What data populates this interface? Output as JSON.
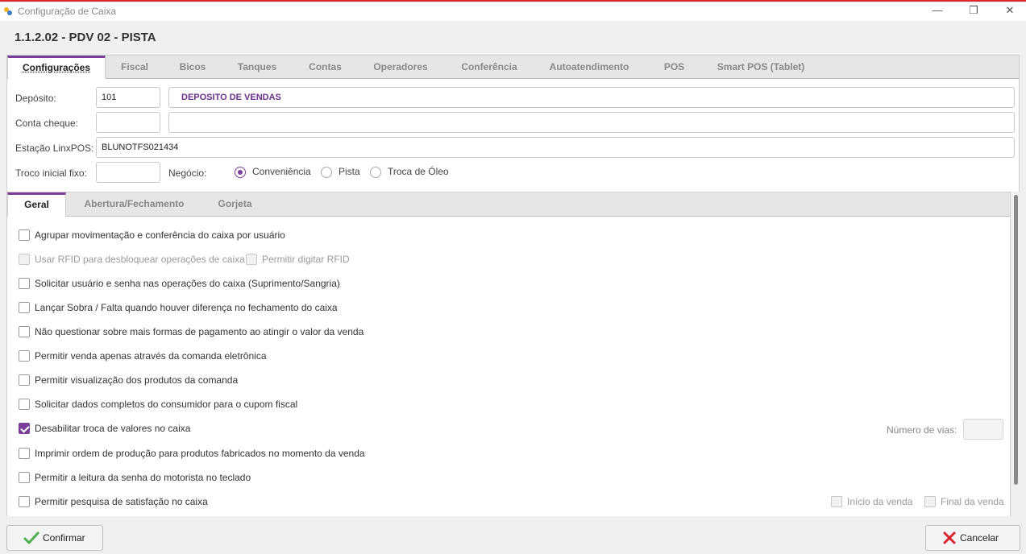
{
  "window": {
    "title": "Configuração de Caixa",
    "minimize": "—",
    "restore": "❐",
    "close": "✕"
  },
  "header": {
    "title": "1.1.2.02 - PDV 02 - PISTA"
  },
  "main_tabs": [
    {
      "label": "Configurações"
    },
    {
      "label": "Fiscal"
    },
    {
      "label": "Bicos"
    },
    {
      "label": "Tanques"
    },
    {
      "label": "Contas"
    },
    {
      "label": "Operadores"
    },
    {
      "label": "Conferência"
    },
    {
      "label": "Autoatendimento"
    },
    {
      "label": "POS"
    },
    {
      "label": "Smart POS (Tablet)"
    }
  ],
  "form": {
    "deposito_label": "Depósito:",
    "deposito_code": "101",
    "deposito_name": "DEPOSITO DE VENDAS",
    "conta_cheque_label": "Conta cheque:",
    "conta_cheque_code": "",
    "conta_cheque_name": "",
    "estacao_label": "Estação LinxPOS:",
    "estacao_value": "BLUNOTFS021434",
    "troco_label": "Troco inicial fixo:",
    "troco_value": "",
    "negocio_label": "Negócio:",
    "negocio_options": [
      {
        "label": "Conveniência",
        "selected": true
      },
      {
        "label": "Pista",
        "selected": false
      },
      {
        "label": "Troca de Óleo",
        "selected": false
      }
    ]
  },
  "sub_tabs": [
    {
      "label": "Geral"
    },
    {
      "label": "Abertura/Fechamento"
    },
    {
      "label": "Gorjeta"
    }
  ],
  "options": [
    {
      "label": "Agrupar movimentação e conferência do caixa por usuário",
      "checked": false,
      "disabled": false
    },
    {
      "label": "Usar RFID para desbloquear operações de caixa",
      "checked": false,
      "disabled": true
    },
    {
      "label": "Permitir digitar RFID",
      "checked": false,
      "disabled": true
    },
    {
      "label": "Solicitar usuário e senha nas operações do caixa (Suprimento/Sangria)",
      "checked": false,
      "disabled": false
    },
    {
      "label": "Lançar Sobra / Falta quando houver diferença no fechamento do caixa",
      "checked": false,
      "disabled": false
    },
    {
      "label": "Não questionar sobre mais formas de pagamento ao atingir o valor da venda",
      "checked": false,
      "disabled": false
    },
    {
      "label": "Permitir venda apenas através da comanda eletrônica",
      "checked": false,
      "disabled": false
    },
    {
      "label": "Permitir visualização dos produtos da comanda",
      "checked": false,
      "disabled": false
    },
    {
      "label": "Solicitar dados completos do consumidor para o cupom fiscal",
      "checked": false,
      "disabled": false
    },
    {
      "label": "Desabilitar troca de valores no caixa",
      "checked": true,
      "disabled": false
    },
    {
      "label": "Imprimir ordem de produção para produtos fabricados no momento da venda",
      "checked": false,
      "disabled": false
    },
    {
      "label": "Permitir a leitura da senha do motorista no teclado",
      "checked": false,
      "disabled": false
    },
    {
      "label": "Permitir pesquisa de satisfação no caixa",
      "checked": false,
      "disabled": false
    },
    {
      "label": "Início da venda",
      "checked": false,
      "disabled": true
    },
    {
      "label": "Final da venda",
      "checked": false,
      "disabled": true
    }
  ],
  "numero_vias": {
    "label": "Número de vias:",
    "value": ""
  },
  "footer": {
    "confirm_label": "Confirmar",
    "cancel_label": "Cancelar"
  },
  "colors": {
    "accent": "#7b3f98",
    "title_border": "#d9262c"
  }
}
